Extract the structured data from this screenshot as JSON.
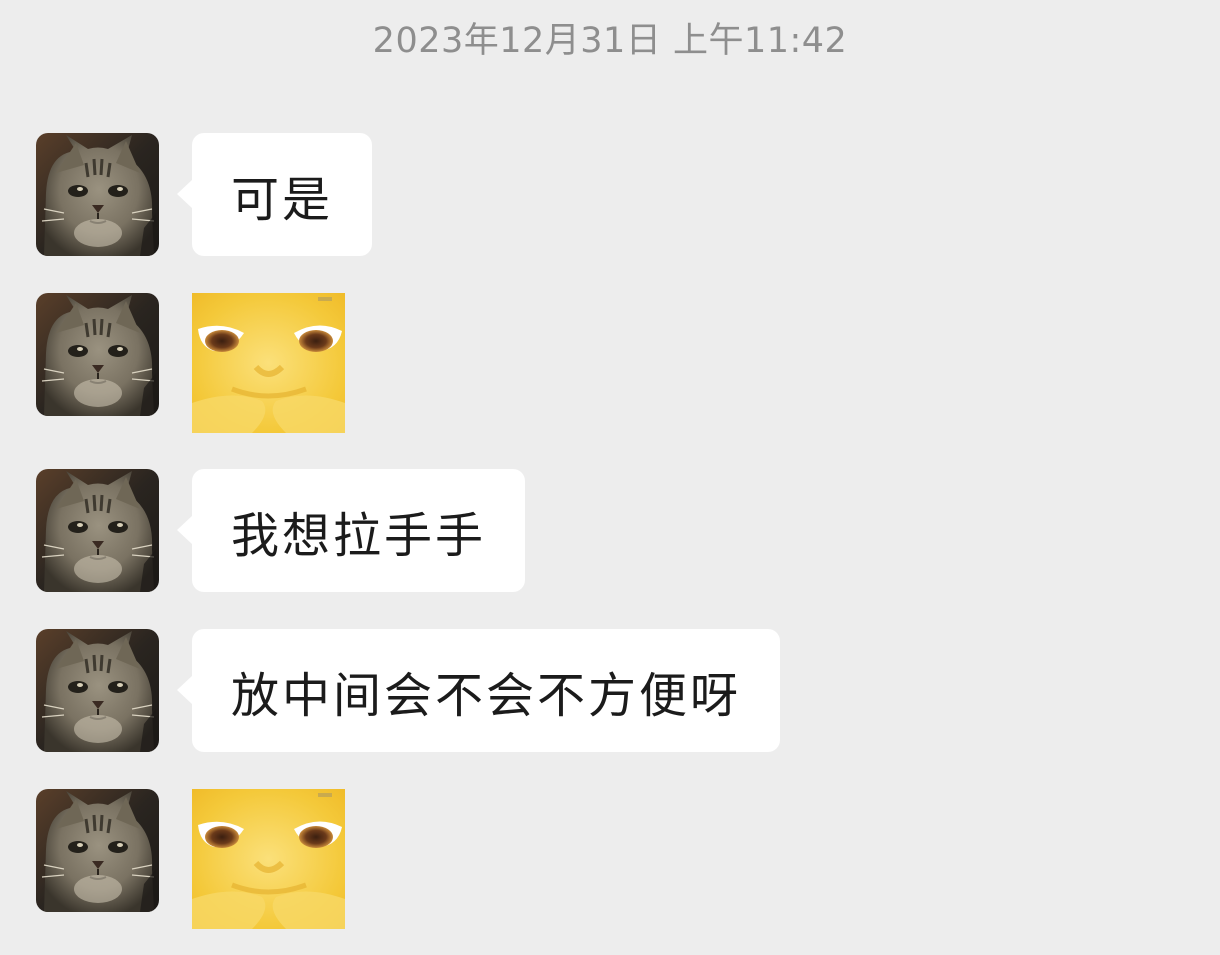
{
  "chat": {
    "timestamp": "2023年12月31日 上午11:42",
    "messages": [
      {
        "type": "text",
        "sender_avatar": "cat-avatar",
        "text": "可是"
      },
      {
        "type": "sticker",
        "sender_avatar": "cat-avatar",
        "sticker": "yellow-face-sticker"
      },
      {
        "type": "text",
        "sender_avatar": "cat-avatar",
        "text": "我想拉手手"
      },
      {
        "type": "text",
        "sender_avatar": "cat-avatar",
        "text": "放中间会不会不方便呀"
      },
      {
        "type": "sticker",
        "sender_avatar": "cat-avatar",
        "sticker": "yellow-face-sticker"
      }
    ]
  },
  "colors": {
    "background": "#ededed",
    "bubble": "#ffffff",
    "timestamp_text": "#8e8e8e",
    "message_text": "#1b1b1b",
    "sticker_yellow": "#f6cf3c"
  }
}
